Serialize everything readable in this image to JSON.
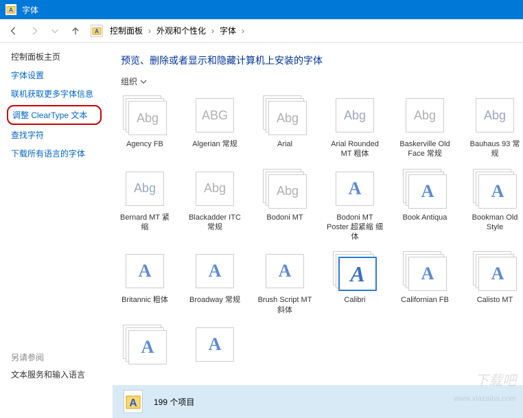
{
  "titlebar": {
    "title": "字体"
  },
  "breadcrumb": [
    "控制面板",
    "外观和个性化",
    "字体"
  ],
  "sidebar": {
    "home": "控制面板主页",
    "links": [
      "字体设置",
      "联机获取更多字体信息",
      "调整 ClearType 文本",
      "查找字符",
      "下载所有语言的字体"
    ],
    "see_also_title": "另请参阅",
    "see_also": [
      "文本服务和输入语言"
    ]
  },
  "heading": "预览、删除或者显示和隐藏计算机上安装的字体",
  "toolbar": {
    "organize": "组织"
  },
  "fonts": [
    [
      {
        "name": "Agency FB",
        "sample": "Abg",
        "cls": "gray",
        "stack": true
      },
      {
        "name": "Algerian 常规",
        "sample": "ABG",
        "cls": "gray",
        "stack": false
      },
      {
        "name": "Arial",
        "sample": "Abg",
        "cls": "gray",
        "stack": true
      },
      {
        "name": "Arial Rounded MT 粗体",
        "sample": "Abg",
        "cls": "",
        "stack": false
      },
      {
        "name": "Baskerville Old Face 常规",
        "sample": "Abg",
        "cls": "gray",
        "stack": false
      },
      {
        "name": "Bauhaus 93 常规",
        "sample": "Abg",
        "cls": "",
        "stack": false
      }
    ],
    [
      {
        "name": "Bernard MT 紧缩",
        "sample": "Abg",
        "cls": "",
        "stack": false
      },
      {
        "name": "Blackadder ITC 常规",
        "sample": "Abg",
        "cls": "gray",
        "stack": false
      },
      {
        "name": "Bodoni MT",
        "sample": "Abg",
        "cls": "gray",
        "stack": true
      },
      {
        "name": "Bodoni MT Poster 超紧缩 细体",
        "sample": "A",
        "cls": "blue",
        "stack": false
      },
      {
        "name": "Book Antiqua",
        "sample": "A",
        "cls": "blue",
        "stack": true
      },
      {
        "name": "Bookman Old Style",
        "sample": "A",
        "cls": "blue",
        "stack": true
      }
    ],
    [
      {
        "name": "Britannic 粗体",
        "sample": "A",
        "cls": "blue",
        "stack": false
      },
      {
        "name": "Broadway 常规",
        "sample": "A",
        "cls": "blue",
        "stack": false
      },
      {
        "name": "Brush Script MT 斜体",
        "sample": "A",
        "cls": "blue",
        "stack": false
      },
      {
        "name": "Calibri",
        "sample": "A",
        "cls": "bigA",
        "stack": true,
        "selected": true
      },
      {
        "name": "Californian FB",
        "sample": "A",
        "cls": "blue",
        "stack": true
      },
      {
        "name": "Calisto MT",
        "sample": "A",
        "cls": "blue",
        "stack": true
      }
    ],
    [
      {
        "name": "",
        "sample": "A",
        "cls": "blue",
        "stack": true
      },
      {
        "name": "",
        "sample": "A",
        "cls": "blue",
        "stack": false
      }
    ]
  ],
  "statusbar": {
    "count": "199 个项目"
  },
  "watermark": {
    "brand": "下载吧",
    "url": "www.xiazaiba.com"
  }
}
